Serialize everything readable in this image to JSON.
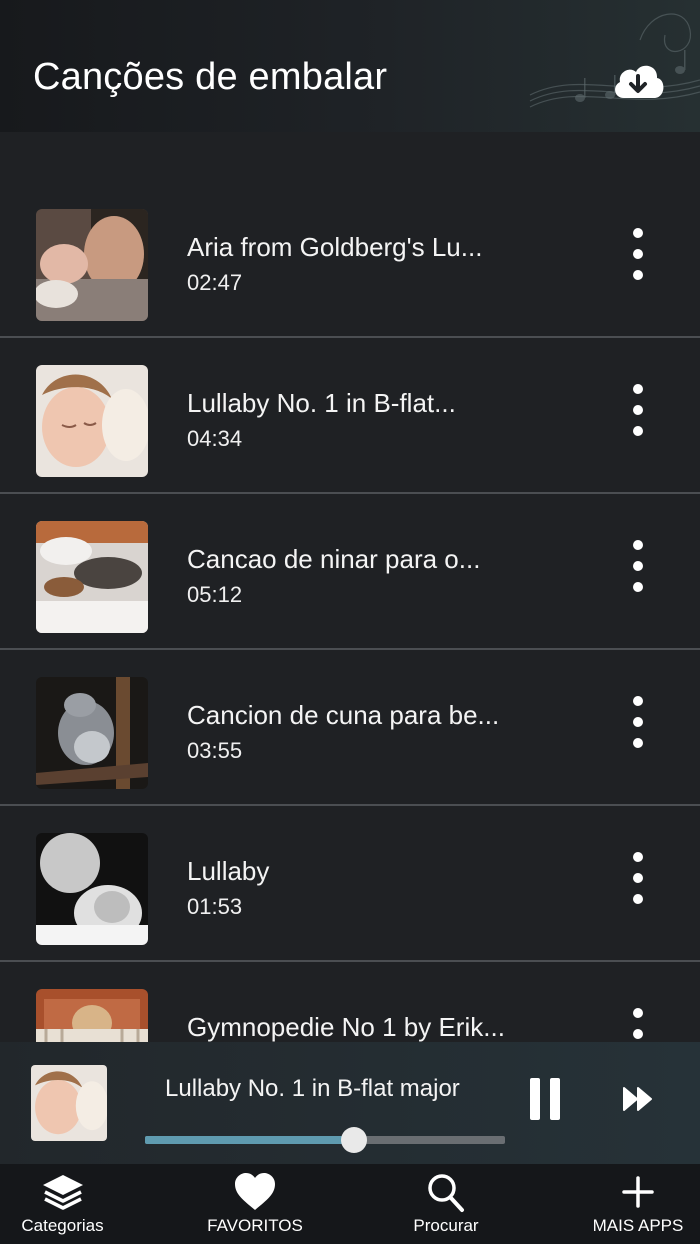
{
  "header": {
    "title": "Canções de embalar"
  },
  "songs": [
    {
      "title": "Aria from Goldberg's Lu...",
      "duration": "02:47",
      "thumb": "father-baby"
    },
    {
      "title": "Lullaby No. 1 in B-flat...",
      "duration": "04:34",
      "thumb": "sleeping-girl"
    },
    {
      "title": "Cancao de ninar para o...",
      "duration": "05:12",
      "thumb": "sleeping-dogs"
    },
    {
      "title": "Cancion de cuna para be...",
      "duration": "03:55",
      "thumb": "koala"
    },
    {
      "title": "Lullaby",
      "duration": "01:53",
      "thumb": "father-baby-bw"
    },
    {
      "title": "Gymnopedie No 1 by Erik...",
      "duration": "",
      "thumb": "baby-crib"
    }
  ],
  "player": {
    "title": "Lullaby No. 1 in B-flat major",
    "progress": 0.58
  },
  "tabs": [
    {
      "label": "Categorias",
      "icon": "layers-icon"
    },
    {
      "label": "FAVORITOS",
      "icon": "heart-icon"
    },
    {
      "label": "Procurar",
      "icon": "search-icon"
    },
    {
      "label": "MAIS APPS",
      "icon": "plus-icon"
    }
  ],
  "colors": {
    "background": "#1f2124",
    "progress": "#5f9bb0",
    "divider": "#4b4e52"
  }
}
